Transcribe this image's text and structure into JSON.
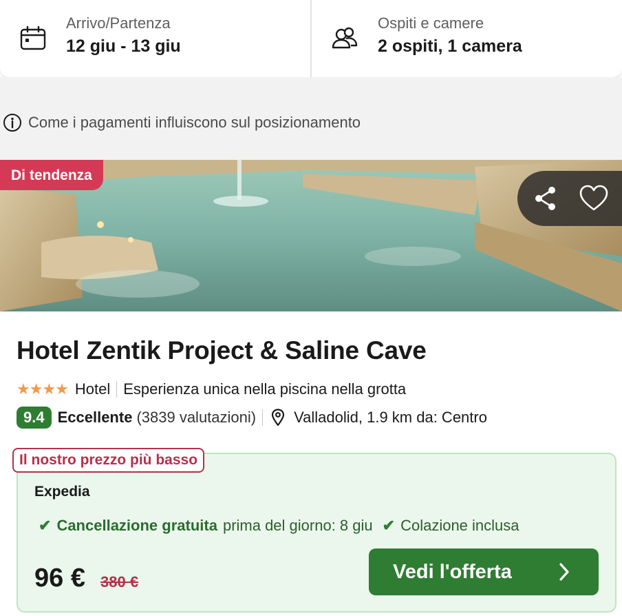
{
  "search_bar": {
    "dates": {
      "label": "Arrivo/Partenza",
      "value": "12 giu - 13 giu",
      "icon": "calendar-icon"
    },
    "guests": {
      "label": "Ospiti e camere",
      "value": "2 ospiti, 1 camera",
      "icon": "guests-icon"
    }
  },
  "info": {
    "text": "Come i pagamenti influiscono sul posizionamento",
    "icon": "info-icon"
  },
  "hotel": {
    "trend_badge": "Di tendenza",
    "name": "Hotel Zentik Project & Saline Cave",
    "stars": "★★★★",
    "type": "Hotel",
    "highlight": "Esperienza unica nella piscina nella grotta",
    "score": "9.4",
    "verdict": "Eccellente",
    "reviews": "(3839 valutazioni)",
    "location": "Valladolid, 1.9 km da: Centro"
  },
  "deal": {
    "badge": "Il nostro prezzo più basso",
    "provider": "Expedia",
    "cancellation": "Cancellazione gratuita",
    "cancellation_detail": "prima del giorno: 8 giu",
    "breakfast": "Colazione inclusa",
    "price": "96 €",
    "old_price": "380 €",
    "cta": "Vedi l'offerta"
  },
  "colors": {
    "brand_green": "#2e7d32",
    "trend_red": "#d43a56",
    "deal_bg": "#ebf7ec",
    "strike_red": "#b5304a",
    "star_orange": "#f2994a"
  }
}
